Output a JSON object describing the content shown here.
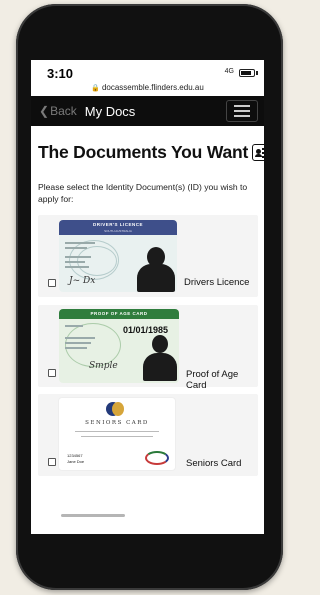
{
  "status": {
    "time": "3:10",
    "url": "docassemble.flinders.edu.au",
    "network": "4G"
  },
  "nav": {
    "back_label": "Back",
    "title": "My Docs"
  },
  "page": {
    "heading": "The Documents You Want",
    "prompt": "Please select the Identity Document(s) (ID) you wish to apply for:"
  },
  "documents": [
    {
      "label": "Drivers Licence",
      "checked": false,
      "card": {
        "title": "DRIVER'S LICENCE",
        "subtitle": "SOUTH AUSTRALIA"
      }
    },
    {
      "label": "Proof of Age Card",
      "checked": false,
      "card": {
        "title": "PROOF OF AGE CARD",
        "date": "01/01/1985"
      }
    },
    {
      "label": "Seniors Card",
      "checked": false,
      "card": {
        "title": "SENIORS CARD",
        "number": "1234567",
        "name": "Jane Doe"
      }
    }
  ],
  "colors": {
    "navbar_bg": "#0d0d0d",
    "licence_band": "#3e4f8a",
    "proof_of_age_band": "#2f7d3d",
    "seniors_blue": "#233a7a",
    "seniors_gold": "#d6a53a"
  },
  "icons": {
    "back": "chevron-left-icon",
    "menu": "hamburger-menu-icon",
    "heading": "id-card-icon",
    "lock": "lock-icon"
  }
}
